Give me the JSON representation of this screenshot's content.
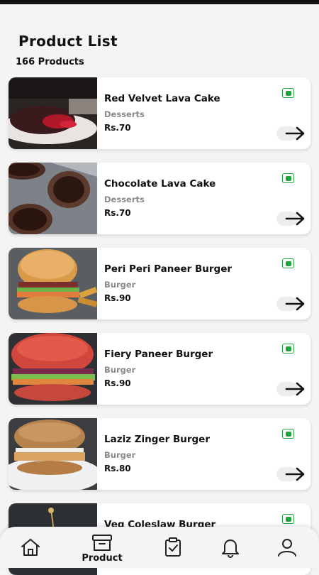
{
  "header": {
    "title": "Product List",
    "count": "166 Products"
  },
  "products": [
    {
      "name": "Red Velvet Lava Cake",
      "category": "Desserts",
      "price": "Rs.70",
      "image": "red-velvet-lava-cake-photo",
      "veg": true
    },
    {
      "name": "Chocolate Lava Cake",
      "category": "Desserts",
      "price": "Rs.70",
      "image": "chocolate-lava-cake-photo",
      "veg": true
    },
    {
      "name": "Peri Peri Paneer Burger",
      "category": "Burger",
      "price": "Rs.90",
      "image": "peri-peri-paneer-burger-photo",
      "veg": true
    },
    {
      "name": "Fiery Paneer Burger",
      "category": "Burger",
      "price": "Rs.90",
      "image": "fiery-paneer-burger-photo",
      "veg": true
    },
    {
      "name": "Laziz Zinger Burger",
      "category": "Burger",
      "price": "Rs.80",
      "image": "laziz-zinger-burger-photo",
      "veg": true
    },
    {
      "name": "Veg Coleslaw Burger",
      "category": "",
      "price": "",
      "image": "veg-coleslaw-burger-photo",
      "veg": true
    }
  ],
  "icons": {
    "veg": "veg-indicator-icon",
    "arrow": "arrow-right-icon"
  },
  "colors": {
    "veg_green": "#23a33d",
    "background": "#f4f4f4",
    "card": "#ffffff"
  },
  "nav": {
    "items": [
      {
        "icon": "home-icon",
        "label": ""
      },
      {
        "icon": "archive-box-icon",
        "label": "Product",
        "active": true
      },
      {
        "icon": "clipboard-check-icon",
        "label": ""
      },
      {
        "icon": "bell-icon",
        "label": ""
      },
      {
        "icon": "user-icon",
        "label": ""
      }
    ]
  }
}
